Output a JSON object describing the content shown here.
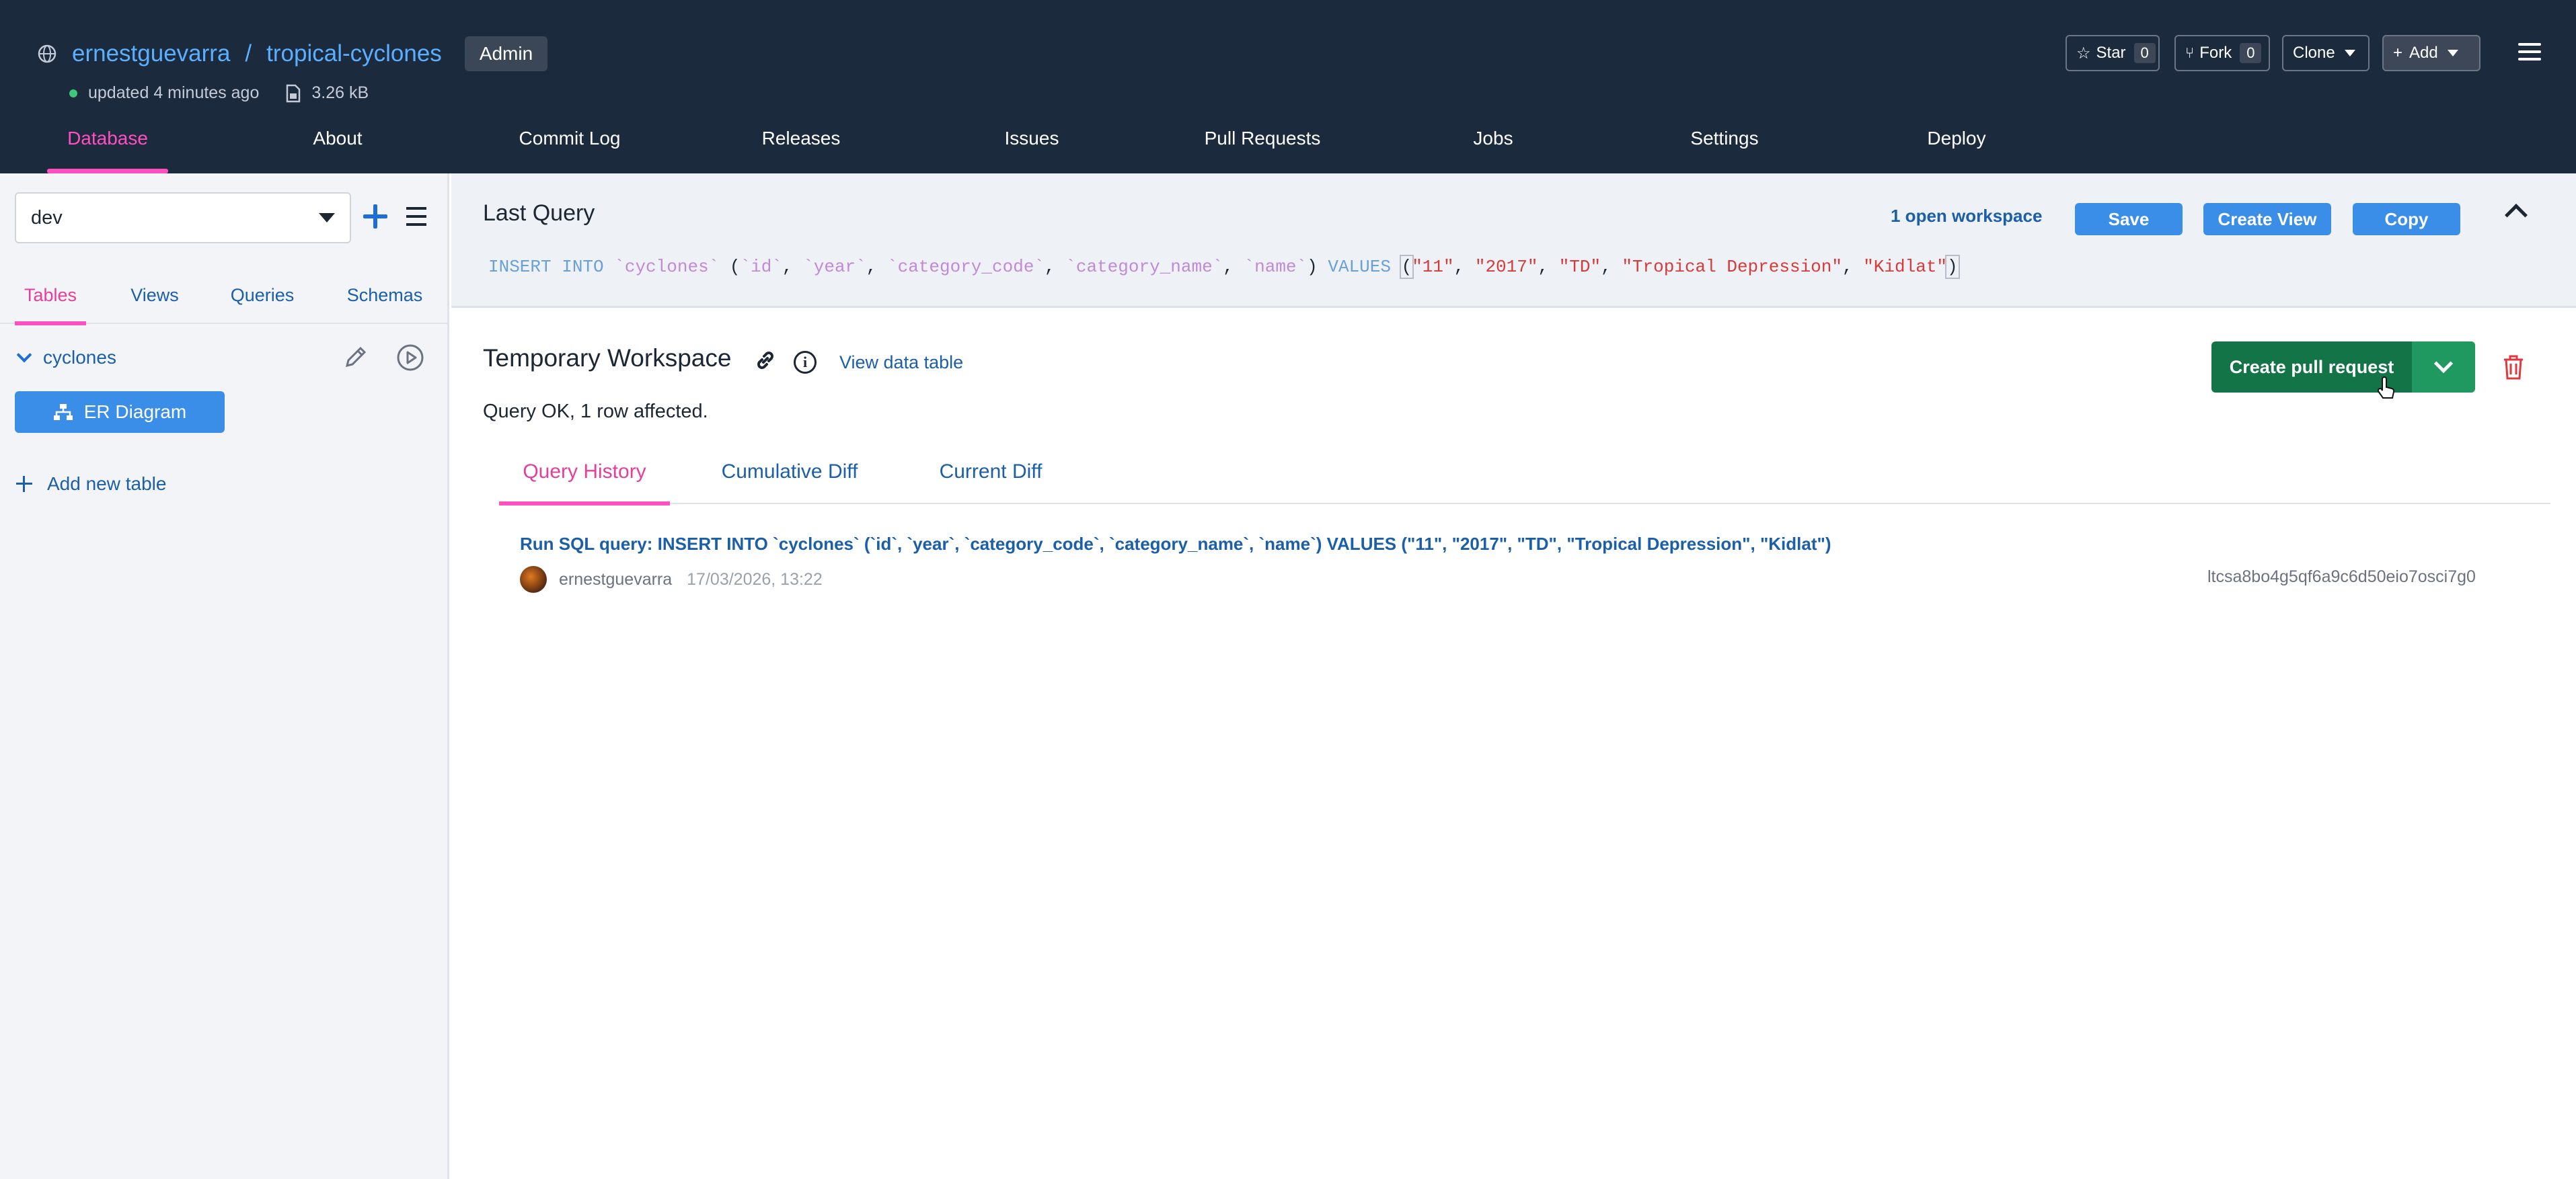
{
  "repo": {
    "owner": "ernestguevarra",
    "separator": "/",
    "name": "tropical-cyclones",
    "role_badge": "Admin",
    "updated": "updated 4 minutes ago",
    "size": "3.26 kB"
  },
  "header_buttons": {
    "star_label": "Star",
    "star_count": "0",
    "fork_label": "Fork",
    "fork_count": "0",
    "clone_label": "Clone",
    "add_label": "Add"
  },
  "nav": {
    "tabs": [
      "Database",
      "About",
      "Commit Log",
      "Releases",
      "Issues",
      "Pull Requests",
      "Jobs",
      "Settings",
      "Deploy"
    ],
    "active": "Database"
  },
  "sidebar": {
    "branch": "dev",
    "tabs": [
      "Tables",
      "Views",
      "Queries",
      "Schemas"
    ],
    "active_tab": "Tables",
    "table_name": "cyclones",
    "er_button": "ER Diagram",
    "add_table": "Add new table"
  },
  "last_query": {
    "title": "Last Query",
    "open_workspace": "1 open workspace",
    "save": "Save",
    "create_view": "Create View",
    "copy": "Copy",
    "sql": {
      "kw_insert": "INSERT INTO",
      "table": "`cyclones`",
      "cols": [
        "`id`",
        "`year`",
        "`category_code`",
        "`category_name`",
        "`name`"
      ],
      "kw_values": "VALUES",
      "values": [
        "\"11\"",
        "\"2017\"",
        "\"TD\"",
        "\"Tropical Depression\"",
        "\"Kidlat\""
      ]
    }
  },
  "workspace": {
    "title": "Temporary Workspace",
    "view_data": "View data table",
    "status": "Query OK, 1 row affected.",
    "create_pr": "Create pull request",
    "tabs": [
      "Query History",
      "Cumulative Diff",
      "Current Diff"
    ],
    "active_tab": "Query History",
    "history": {
      "query": "Run SQL query: INSERT INTO `cyclones` (`id`, `year`, `category_code`, `category_name`, `name`) VALUES (\"11\", \"2017\", \"TD\", \"Tropical Depression\", \"Kidlat\")",
      "user": "ernestguevarra",
      "time": "17/03/2026, 13:22",
      "hash": "ltcsa8bo4g5qf6a9c6d50eio7osci7g0"
    }
  },
  "colors": {
    "header_bg": "#1c2a3e",
    "accent_pink": "#ff4fc1",
    "link_blue": "#1b5fa8",
    "button_blue": "#3b8ee8",
    "pr_green": "#137448"
  }
}
